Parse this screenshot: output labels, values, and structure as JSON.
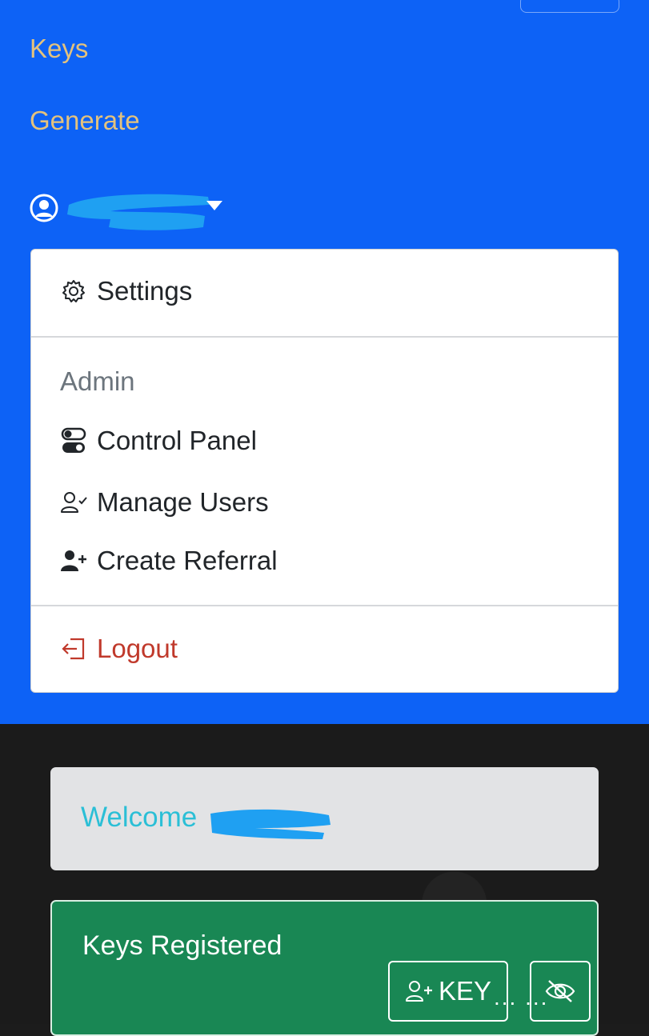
{
  "nav": {
    "links": [
      "Keys",
      "Generate"
    ],
    "user": {
      "name_redacted": true
    }
  },
  "dropdown": {
    "settings_label": "Settings",
    "admin_header": "Admin",
    "control_panel_label": "Control Panel",
    "manage_users_label": "Manage Users",
    "create_referral_label": "Create Referral",
    "logout_label": "Logout"
  },
  "welcome": {
    "label": "Welcome"
  },
  "keys_card": {
    "title": "Keys Registered",
    "add_key_label": "KEY",
    "dots": "... ..."
  },
  "colors": {
    "navbar": "#0d62f6",
    "nav_link": "#e3c27e",
    "logout": "#c0392b",
    "welcome_text": "#2bbfd6",
    "keys_card": "#198754"
  },
  "icons": [
    "gear-icon",
    "toggles-icon",
    "person-check-icon",
    "person-plus-fill-icon",
    "logout-icon",
    "user-circle-icon",
    "person-plus-icon",
    "eye-slash-icon",
    "caret-down-icon"
  ]
}
